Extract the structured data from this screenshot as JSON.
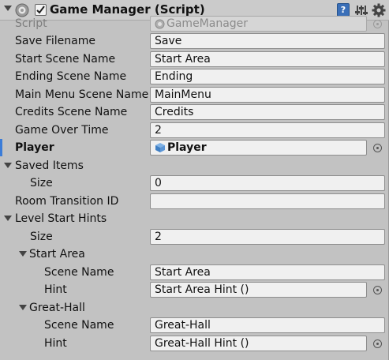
{
  "header": {
    "title": "Game Manager (Script)",
    "enabled": true,
    "help_icon": "help-book-icon",
    "preset_icon": "preset-sliders-icon",
    "settings_icon": "gear-icon",
    "foldout_icon": "chevron-down-icon",
    "script_icon": "csharp-script-icon",
    "help_glyph": "?"
  },
  "fields": {
    "script": {
      "label": "Script",
      "value": "GameManager"
    },
    "save_filename": {
      "label": "Save Filename",
      "value": "Save"
    },
    "start_scene": {
      "label": "Start Scene Name",
      "value": "Start Area"
    },
    "ending_scene": {
      "label": "Ending Scene Name",
      "value": "Ending"
    },
    "main_menu_scene": {
      "label": "Main Menu Scene Name",
      "value": "MainMenu"
    },
    "credits_scene": {
      "label": "Credits Scene Name",
      "value": "Credits"
    },
    "game_over_time": {
      "label": "Game Over Time",
      "value": "2"
    },
    "player": {
      "label": "Player",
      "value": "Player"
    },
    "saved_items": {
      "label": "Saved Items",
      "size_label": "Size",
      "size": "0"
    },
    "room_transition": {
      "label": "Room Transition ID",
      "value": ""
    },
    "level_start_hints": {
      "label": "Level Start Hints",
      "size_label": "Size",
      "size": "2",
      "elements": [
        {
          "name": "Start Area",
          "scene_label": "Scene Name",
          "scene": "Start Area",
          "hint_label": "Hint",
          "hint": "Start Area Hint ()"
        },
        {
          "name": "Great-Hall",
          "scene_label": "Scene Name",
          "scene": "Great-Hall",
          "hint_label": "Hint",
          "hint": "Great-Hall Hint ()"
        }
      ]
    }
  },
  "colors": {
    "panel_bg": "#c2c2c2",
    "field_bg": "#f0f0f0",
    "highlight": "#3b7cd8"
  }
}
